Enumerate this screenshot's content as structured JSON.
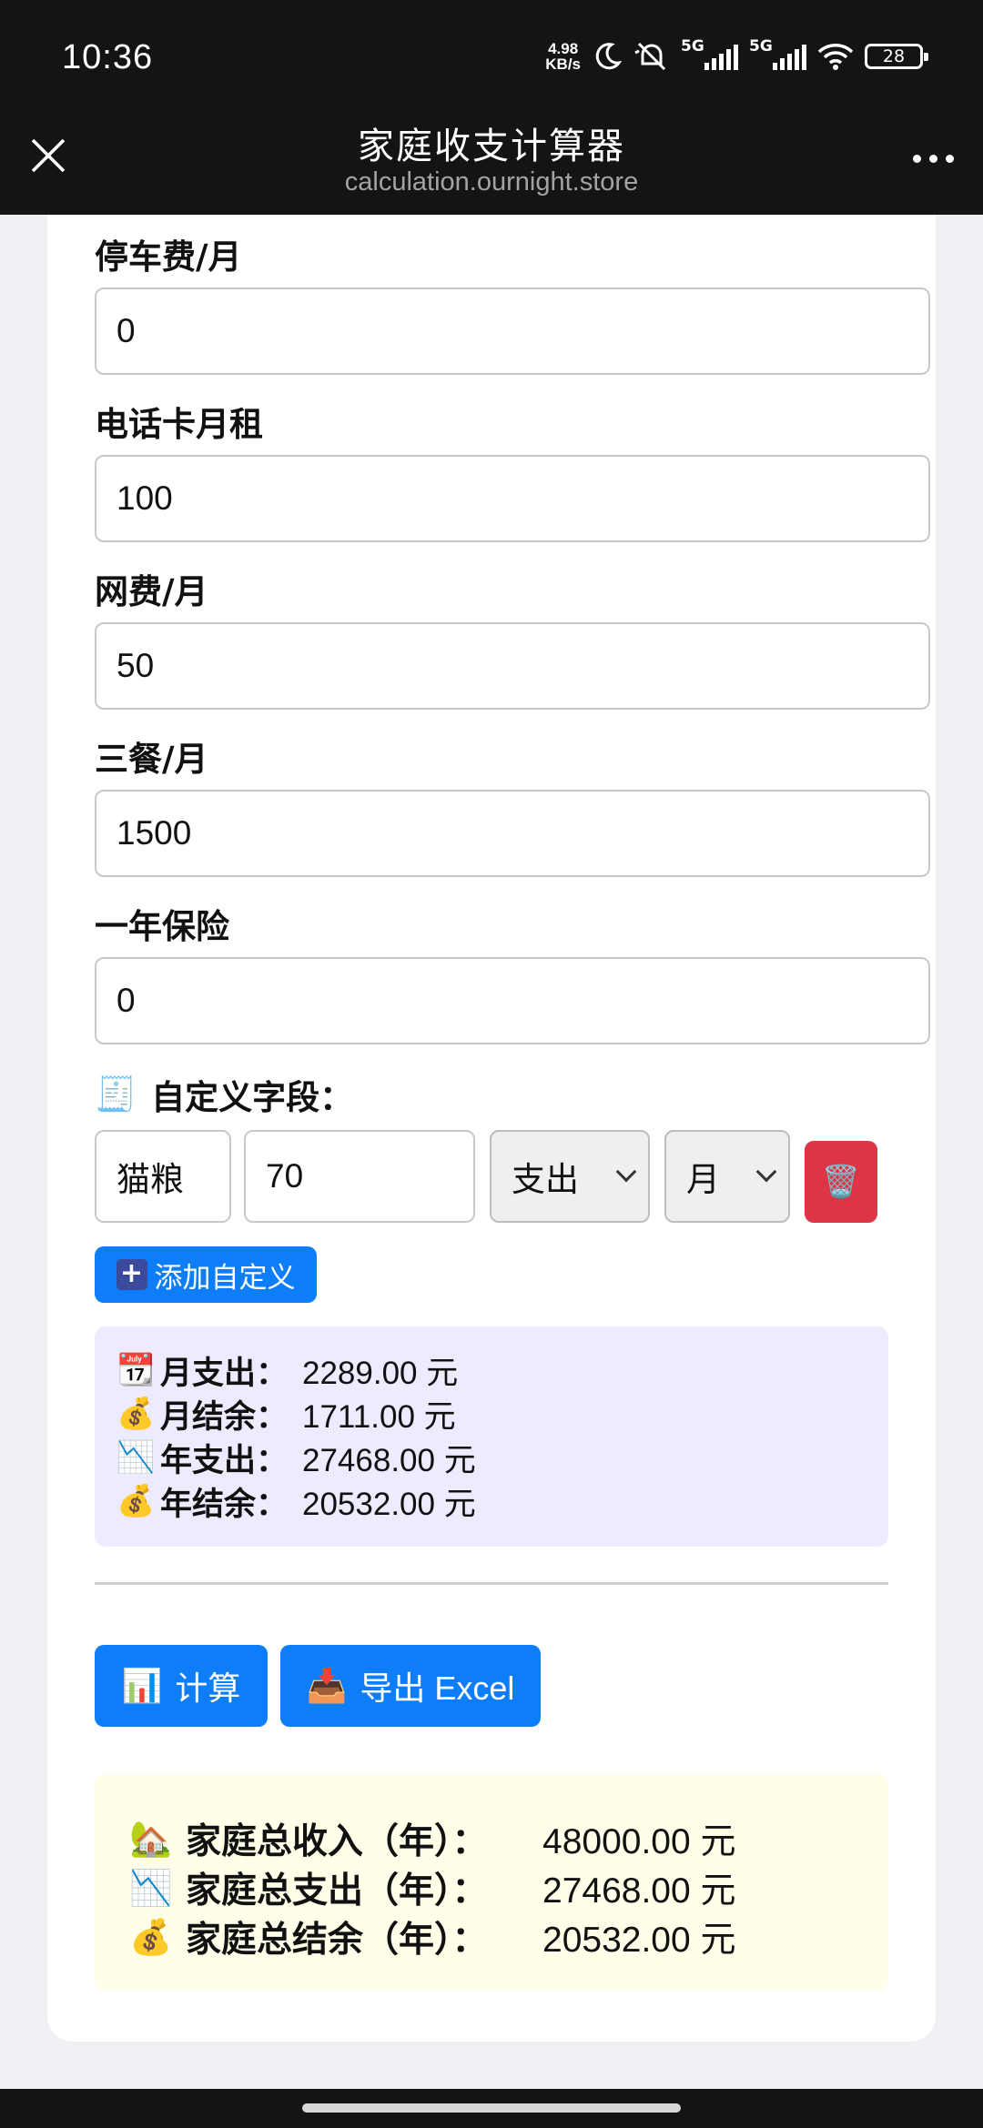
{
  "status": {
    "time": "10:36",
    "speed_value": "4.98",
    "speed_unit": "KB/s",
    "sim1": "5G",
    "sim2": "5G",
    "battery": "28"
  },
  "appbar": {
    "title": "家庭收支计算器",
    "url": "calculation.ournight.store"
  },
  "fields": [
    {
      "label": "停车费/月",
      "value": "0"
    },
    {
      "label": "电话卡月租",
      "value": "100"
    },
    {
      "label": "网费/月",
      "value": "50"
    },
    {
      "label": "三餐/月",
      "value": "1500"
    },
    {
      "label": "一年保险",
      "value": "0"
    }
  ],
  "custom": {
    "heading_icon": "🧾",
    "heading": "自定义字段：",
    "name": "猫粮",
    "amount": "70",
    "type": "支出",
    "period": "月",
    "delete_icon": "🗑️",
    "add_label": "添加自定义"
  },
  "summary": [
    {
      "icon": "📆",
      "label": "月支出：",
      "value": "2289.00 元"
    },
    {
      "icon": "💰",
      "label": "月结余：",
      "value": "1711.00 元"
    },
    {
      "icon": "📉",
      "label": "年支出：",
      "value": "27468.00 元"
    },
    {
      "icon": "💰",
      "label": "年结余：",
      "value": "20532.00 元"
    }
  ],
  "actions": {
    "calc_icon": "📊",
    "calc_label": "计算",
    "export_icon": "📥",
    "export_label": "导出 Excel"
  },
  "totals": [
    {
      "icon": "🏡",
      "label": "家庭总收入（年）：",
      "value": "48000.00 元"
    },
    {
      "icon": "📉",
      "label": "家庭总支出（年）：",
      "value": "27468.00 元"
    },
    {
      "icon": "💰",
      "label": "家庭总结余（年）：",
      "value": "20532.00 元"
    }
  ],
  "colors": {
    "primary": "#0d7ef8",
    "danger": "#dc3545",
    "summary_bg": "#ecebff",
    "total_bg": "#ffffe9"
  }
}
